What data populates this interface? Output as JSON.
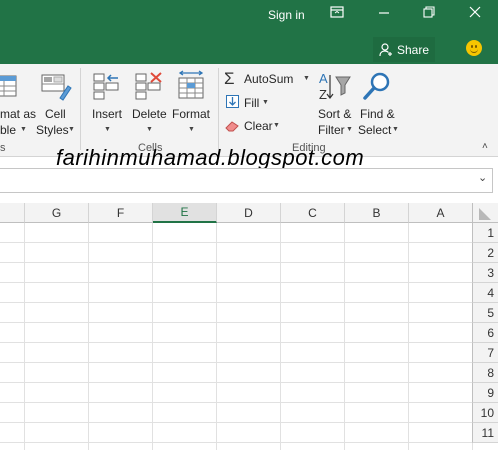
{
  "titlebar": {
    "signin": "Sign in",
    "share": "Share",
    "icons": [
      "ribbon-display-icon",
      "minimize-icon",
      "restore-icon",
      "close-icon",
      "smiley-icon"
    ]
  },
  "ribbon": {
    "styles": {
      "format_as_table_l1": "mat as",
      "format_as_table_l2": "ble",
      "cell_styles_l1": "Cell",
      "cell_styles_l2": "Styles",
      "group_fragment": "s"
    },
    "cells": {
      "insert": "Insert",
      "delete": "Delete",
      "format": "Format",
      "group_label": "Cells"
    },
    "editing": {
      "autosum": "AutoSum",
      "fill": "Fill",
      "clear": "Clear",
      "sort_filter_l1": "Sort &",
      "sort_filter_l2": "Filter",
      "find_select_l1": "Find &",
      "find_select_l2": "Select",
      "group_label": "Editing"
    }
  },
  "watermark": "farihinmuhamad.blogspot.com",
  "columns": [
    "G",
    "F",
    "E",
    "D",
    "C",
    "B",
    "A"
  ],
  "selected_column": "E",
  "rows": [
    "1",
    "2",
    "3",
    "4",
    "5",
    "6",
    "7",
    "8",
    "9",
    "10",
    "11"
  ]
}
